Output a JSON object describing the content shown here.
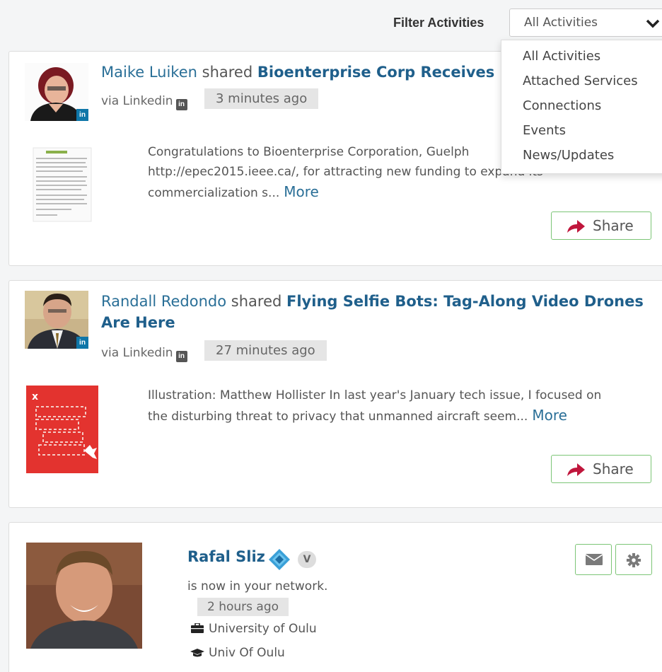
{
  "filter": {
    "label": "Filter Activities",
    "selected": "All Activities",
    "options": [
      "All Activities",
      "Attached Services",
      "Connections",
      "Events",
      "News/Updates"
    ]
  },
  "activities": [
    {
      "user": "Maike Luiken",
      "verb": "shared",
      "title": "Bioenterprise Corp Receives N",
      "via": "via Linkedin",
      "time": "3 minutes ago",
      "body": "Congratulations to Bioenterprise Corporation, Guelph http://epec2015.ieee.ca/, for attracting new funding to expand its commercialization s...",
      "more": "More",
      "share": "Share"
    },
    {
      "user": "Randall Redondo",
      "verb": "shared",
      "title": "Flying Selfie Bots: Tag-Along Video Drones Are Here",
      "via": "via Linkedin",
      "time": "27 minutes ago",
      "body": "Illustration: Matthew Hollister In last year's January tech issue, I focused on the disturbing threat to privacy that unmanned aircraft seem...",
      "more": "More",
      "share": "Share"
    }
  ],
  "connection": {
    "name": "Rafal Sliz",
    "badge": "V",
    "status": "is now in your network.",
    "time": "2 hours ago",
    "work": "University of Oulu",
    "education": "Univ Of Oulu"
  },
  "colors": {
    "link": "#2a6f97",
    "share_border": "#7cc576",
    "share_icon": "#c0163c",
    "linkedin": "#0e76a8"
  }
}
